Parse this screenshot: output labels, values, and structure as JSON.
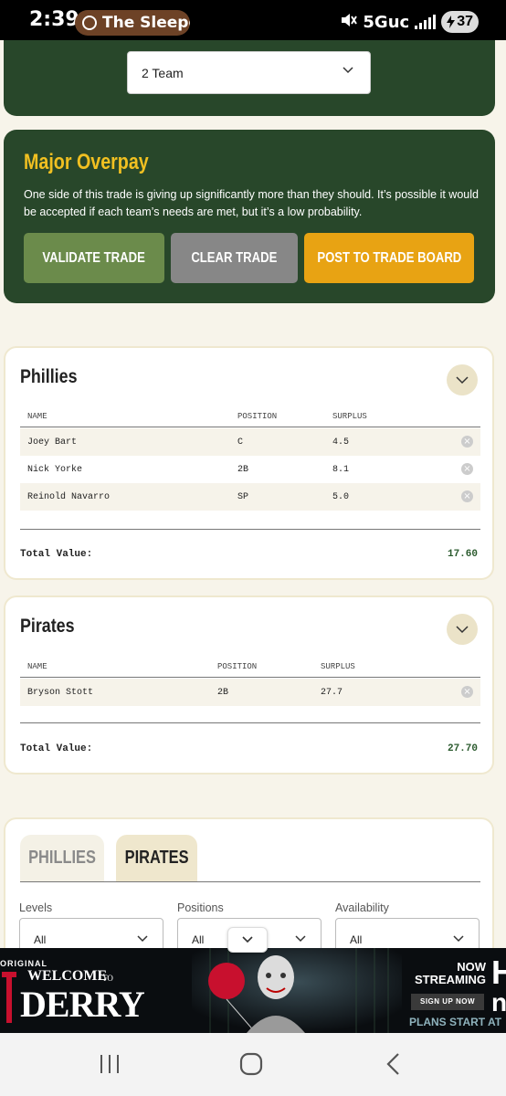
{
  "status_bar": {
    "time": "2:39",
    "notification_app": "The Sleeper",
    "network": "5Guc",
    "battery": "37"
  },
  "trade_setup": {
    "team_count_selected": "2 Team"
  },
  "verdict": {
    "title": "Major Overpay",
    "message": "One side of this trade is giving up significantly more than they should. It’s possible it would be accepted if each team’s needs are met, but it’s a low probability.",
    "buttons": {
      "validate": "VALIDATE TRADE",
      "clear": "CLEAR TRADE",
      "post": "POST TO TRADE BOARD"
    },
    "colors": {
      "title": "#f1c021",
      "panel": "#28472a",
      "validate": "#6b8b4b",
      "clear": "#878787",
      "post": "#e8a313"
    }
  },
  "teams": [
    {
      "name": "Phillies",
      "columns": [
        "NAME",
        "POSITION",
        "SURPLUS"
      ],
      "players": [
        {
          "name": "Joey Bart",
          "position": "C",
          "surplus": "4.5"
        },
        {
          "name": "Nick Yorke",
          "position": "2B",
          "surplus": "8.1"
        },
        {
          "name": "Reinold Navarro",
          "position": "SP",
          "surplus": "5.0"
        }
      ],
      "total_label": "Total Value:",
      "total_value": "17.60"
    },
    {
      "name": "Pirates",
      "columns": [
        "NAME",
        "POSITION",
        "SURPLUS"
      ],
      "players": [
        {
          "name": "Bryson Stott",
          "position": "2B",
          "surplus": "27.7"
        }
      ],
      "total_label": "Total Value:",
      "total_value": "27.70"
    }
  ],
  "browser": {
    "tabs": [
      "PHILLIES",
      "PIRATES"
    ],
    "active_tab": "PIRATES",
    "filters": [
      {
        "label": "Levels",
        "value": "All"
      },
      {
        "label": "Positions",
        "value": "All"
      },
      {
        "label": "Availability",
        "value": "All"
      }
    ]
  },
  "ad": {
    "original": "ORIGINAL",
    "welcome": "WELCOME",
    "to": "TO",
    "derry": "DERRY",
    "now_streaming": "NOW STREAMING",
    "signup": "SIGN UP NOW",
    "plans": "PLANS START AT",
    "brand_h": "H",
    "brand_n": "n"
  },
  "icons": {
    "collapse": "chevron-down-icon",
    "remove": "close-circle-icon",
    "nav_recents": "recents-icon",
    "nav_home": "home-icon",
    "nav_back": "back-icon"
  }
}
